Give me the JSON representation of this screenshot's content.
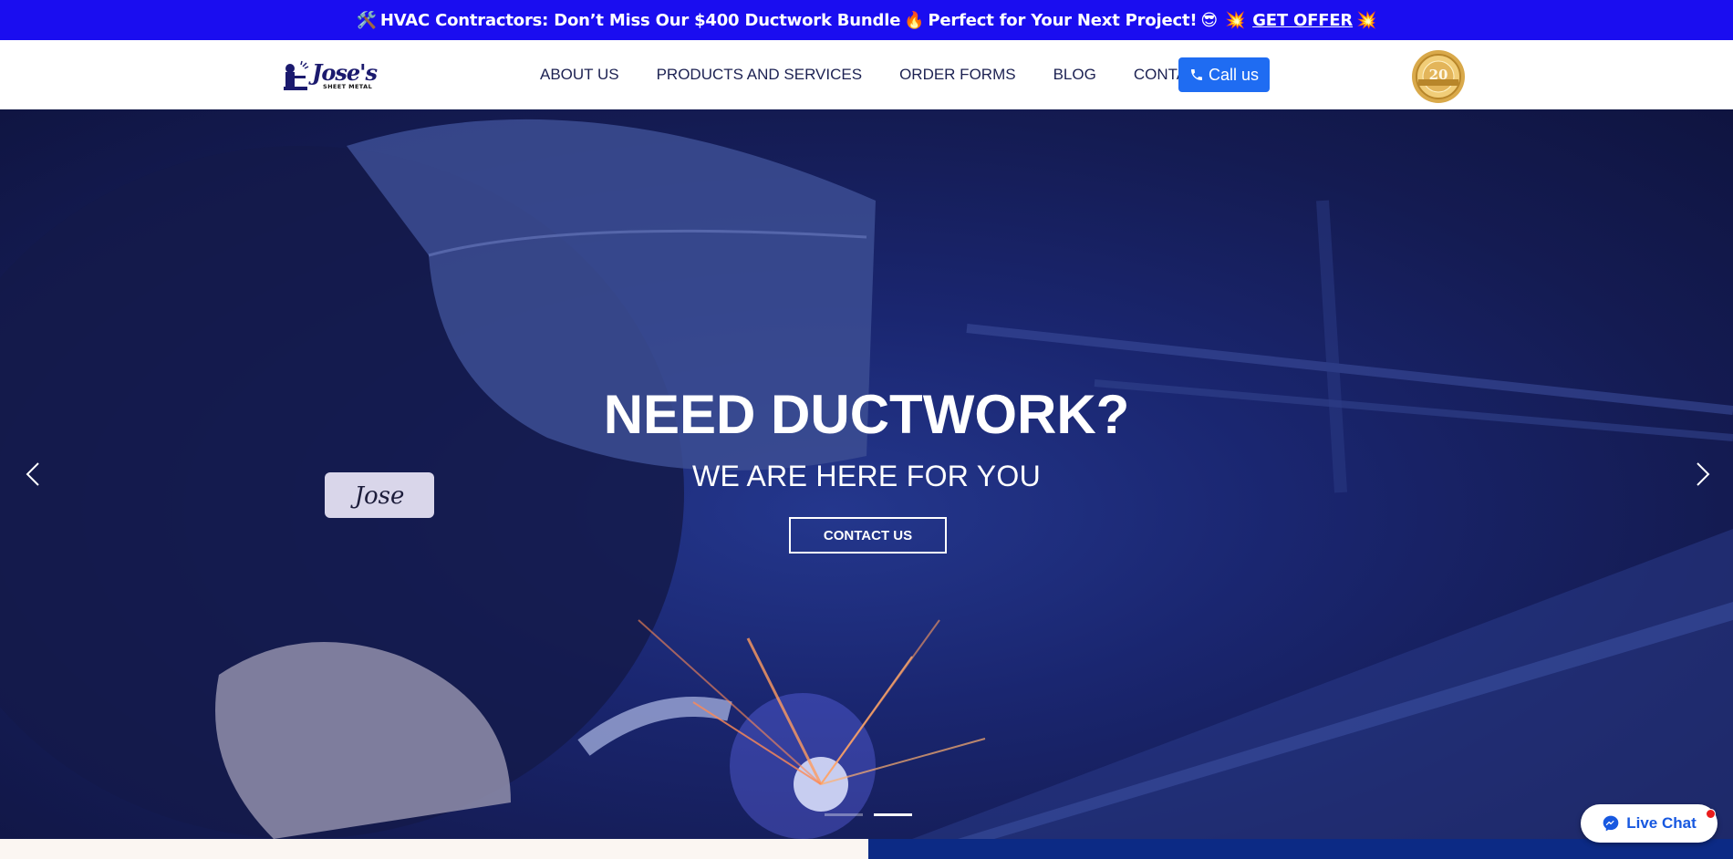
{
  "topbar": {
    "icon_tools": "🛠️",
    "text_main": "HVAC Contractors: Don’t Miss Our $400 Ductwork Bundle",
    "icon_fire": "🔥",
    "text_second": "Perfect for Your Next Project!",
    "icon_sunglasses": "😎",
    "icon_spark_left": "💥",
    "offer_label": "GET OFFER",
    "icon_spark_right": "💥"
  },
  "logo": {
    "name": "Jose's",
    "sub": "SHEET METAL"
  },
  "nav": {
    "items": [
      {
        "label": "ABOUT US"
      },
      {
        "label": "PRODUCTS AND SERVICES"
      },
      {
        "label": "ORDER FORMS"
      },
      {
        "label": "BLOG"
      },
      {
        "label": "CONTACT"
      }
    ],
    "call_label": "Call us",
    "call_icon": "phone-icon"
  },
  "badge": {
    "number": "20"
  },
  "hero": {
    "title": "NEED DUCTWORK?",
    "subtitle": "WE ARE HERE FOR YOU",
    "button_label": "CONTACT US",
    "name_tag": "Jose",
    "slide_count": 2,
    "active_slide": 2
  },
  "chat": {
    "label": "Live Chat",
    "icon": "messenger-icon"
  },
  "colors": {
    "topbar_bg": "#1a0df0",
    "call_button": "#1f6cf2",
    "hero_overlay": "#1a2670",
    "footer_right": "#0c2a85",
    "chat_text": "#1758e0"
  }
}
